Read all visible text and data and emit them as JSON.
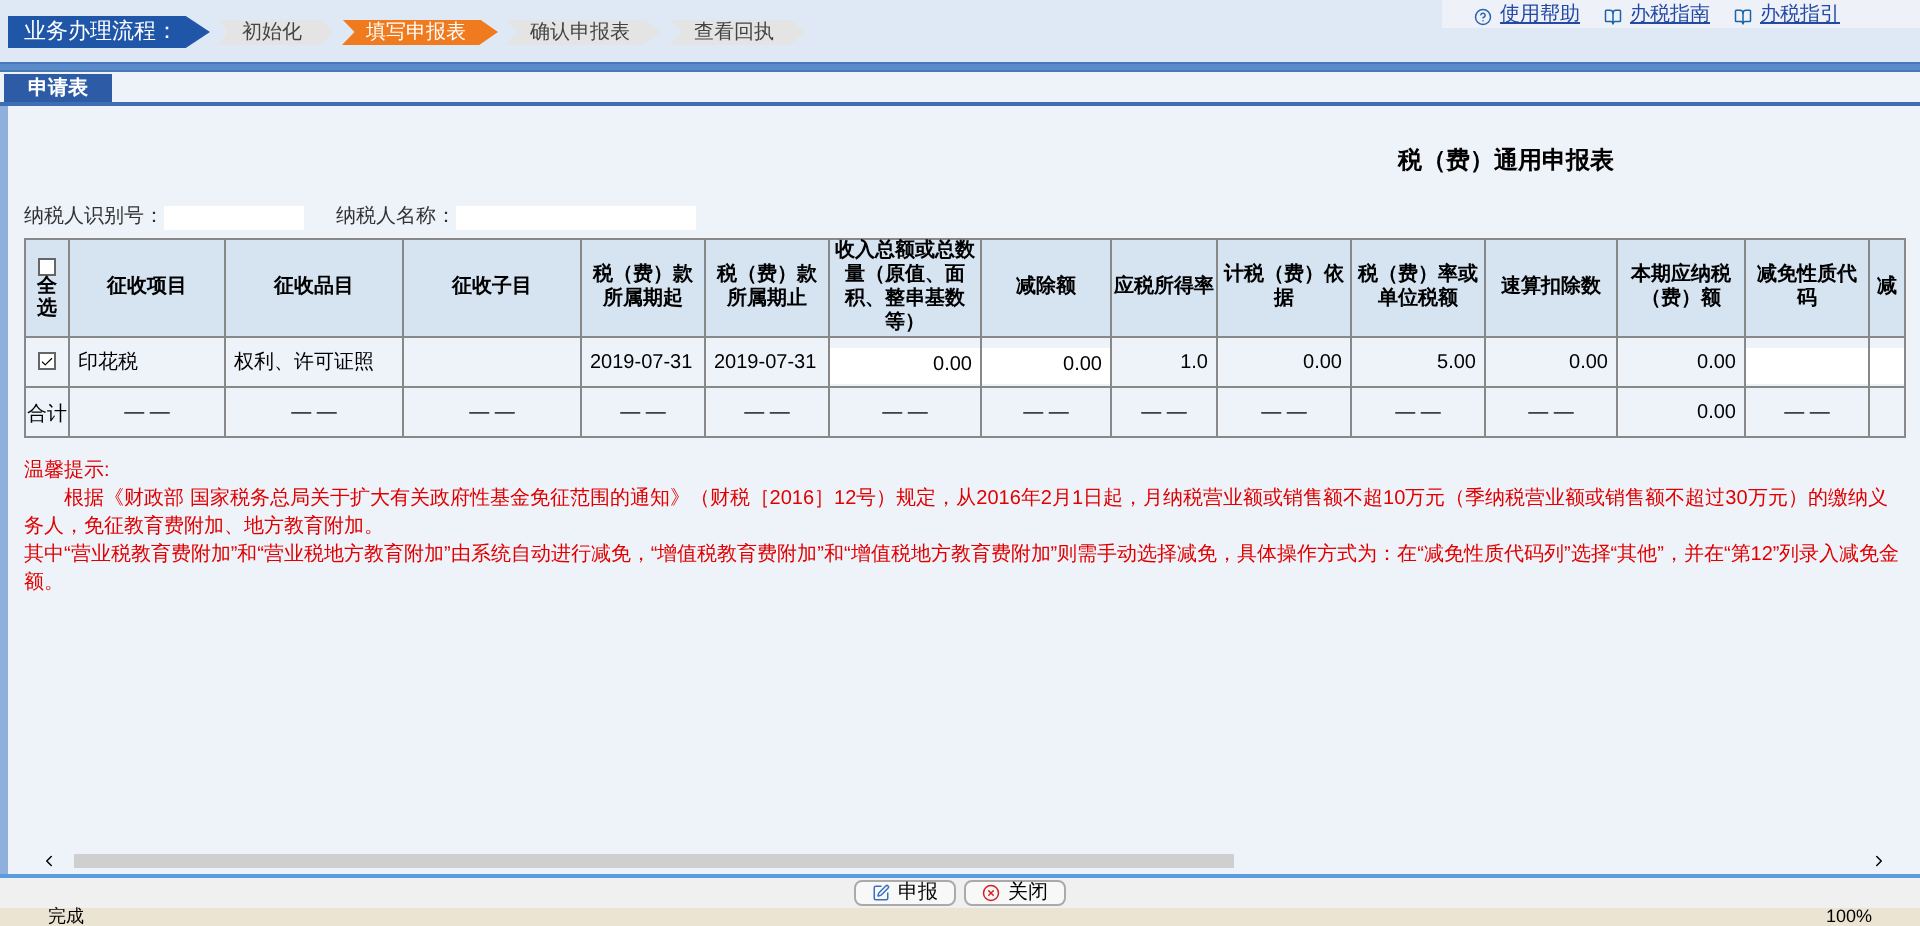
{
  "process": {
    "title": "业务办理流程：",
    "steps": [
      {
        "label": "初始化",
        "selected": false
      },
      {
        "label": "填写申报表",
        "selected": true
      },
      {
        "label": "确认申报表",
        "selected": false
      },
      {
        "label": "查看回执",
        "selected": false
      }
    ]
  },
  "help_links": [
    {
      "label": "使用帮助",
      "kind": "help"
    },
    {
      "label": "办税指南",
      "kind": "book"
    },
    {
      "label": "办税指引",
      "kind": "book"
    }
  ],
  "tabs": [
    {
      "label": "申请表",
      "selected": true
    }
  ],
  "form_title": "税（费）通用申报表",
  "fields": [
    {
      "label": "纳税人识别号："
    },
    {
      "label": "纳税人名称："
    }
  ],
  "table": {
    "select_all": {
      "label": "全选",
      "checked": false
    },
    "columns": [
      "征收项目",
      "征收品目",
      "征收子目",
      "税（费）款所属期起",
      "税（费）款所属期止",
      "收入总额或总数量（原值、面积、整串基数等）",
      "减除额",
      "应税所得率",
      "计税（费）依据",
      "税（费）率或单位税额",
      "速算扣除数",
      "本期应纳税（费）额",
      "减免性质代码",
      "减"
    ],
    "rows": [
      {
        "kind": "item",
        "checked": true,
        "cells": [
          {
            "kind": "text",
            "value": "印花税"
          },
          {
            "kind": "text",
            "value": "权利、许可证照"
          },
          {
            "kind": "text"
          },
          {
            "kind": "text",
            "value": "2019-07-31"
          },
          {
            "kind": "text",
            "value": "2019-07-31"
          },
          {
            "kind": "input",
            "value": "0.00"
          },
          {
            "kind": "input",
            "value": "0.00"
          },
          {
            "kind": "number",
            "value": "1.0"
          },
          {
            "kind": "number",
            "value": "0.00"
          },
          {
            "kind": "number",
            "value": "5.00"
          },
          {
            "kind": "number",
            "value": "0.00"
          },
          {
            "kind": "number",
            "value": "0.00"
          },
          {
            "kind": "input"
          },
          {
            "kind": "input"
          }
        ]
      },
      {
        "kind": "total",
        "label": "合计",
        "cells": [
          {
            "kind": "dash",
            "value": "— —"
          },
          {
            "kind": "dash",
            "value": "— —"
          },
          {
            "kind": "dash",
            "value": "— —"
          },
          {
            "kind": "dash",
            "value": "— —"
          },
          {
            "kind": "dash",
            "value": "— —"
          },
          {
            "kind": "dash",
            "value": "— —"
          },
          {
            "kind": "dash",
            "value": "— —"
          },
          {
            "kind": "dash",
            "value": "— —"
          },
          {
            "kind": "dash",
            "value": "— —"
          },
          {
            "kind": "dash",
            "value": "— —"
          },
          {
            "kind": "dash",
            "value": "— —"
          },
          {
            "kind": "number",
            "value": "0.00"
          },
          {
            "kind": "dash",
            "value": "— —"
          },
          {
            "kind": "dash"
          }
        ]
      }
    ]
  },
  "tips": {
    "title": "温馨提示:",
    "paragraphs": [
      "根据《财政部 国家税务总局关于扩大有关政府性基金免征范围的通知》（财税［2016］12号）规定，从2016年2月1日起，月纳税营业额或销售额不超10万元（季纳税营业额或销售额不超过30万元）的缴纳义务人，免征教育费附加、地方教育附加。",
      "其中“营业税教育费附加”和“营业税地方教育附加”由系统自动进行减免，“增值税教育费附加”和“增值税地方教育费附加”则需手动选择减免，具体操作方式为：在“减免性质代码列”选择“其他”，并在“第12”列录入减免金额。"
    ]
  },
  "buttons": [
    {
      "label": "申报",
      "kind": "submit"
    },
    {
      "label": "关闭",
      "kind": "close"
    }
  ],
  "status_bar": {
    "text": "完成",
    "zoom": "100%"
  }
}
